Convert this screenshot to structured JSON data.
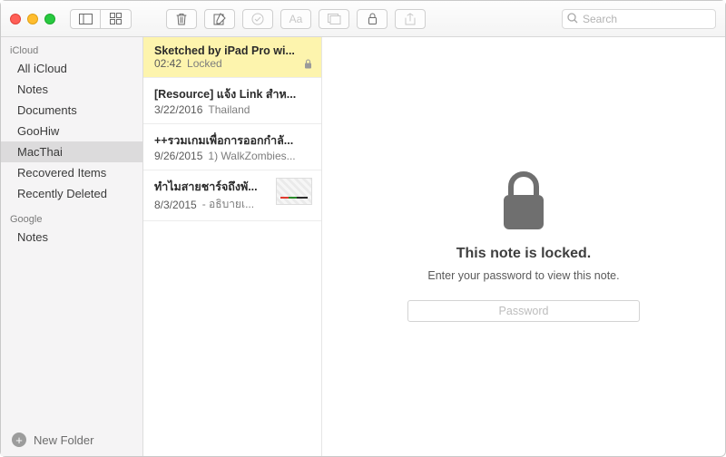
{
  "toolbar": {
    "search_placeholder": "Search"
  },
  "sidebar": {
    "sections": [
      {
        "label": "iCloud",
        "items": [
          "All iCloud",
          "Notes",
          "Documents",
          "GooHiw",
          "MacThai",
          "Recovered Items",
          "Recently Deleted"
        ],
        "selected": 4
      },
      {
        "label": "Google",
        "items": [
          "Notes"
        ],
        "selected": -1
      }
    ],
    "footer": "New Folder"
  },
  "notes": [
    {
      "title": "Sketched by iPad Pro wi...",
      "date": "02:42",
      "preview": "Locked",
      "locked": true,
      "selected": true,
      "thumb": false
    },
    {
      "title": "[Resource] แจ้ง Link สำห...",
      "date": "3/22/2016",
      "preview": "Thailand",
      "locked": false,
      "selected": false,
      "thumb": false
    },
    {
      "title": "++รวมเกมเพื่อการออกกำลั...",
      "date": "9/26/2015",
      "preview": "1) WalkZombies...",
      "locked": false,
      "selected": false,
      "thumb": false
    },
    {
      "title": "ทำไมสายชาร์จถึงพั...",
      "date": "8/3/2015",
      "preview": "- อธิบายเ...",
      "locked": false,
      "selected": false,
      "thumb": true
    }
  ],
  "locked_view": {
    "heading": "This note is locked.",
    "sub": "Enter your password to view this note.",
    "placeholder": "Password"
  }
}
